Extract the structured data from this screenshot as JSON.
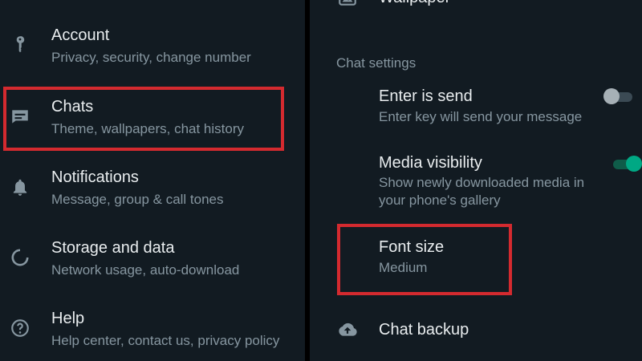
{
  "left_panel": {
    "items": [
      {
        "title": "Account",
        "subtitle": "Privacy, security, change number",
        "icon": "key-icon"
      },
      {
        "title": "Chats",
        "subtitle": "Theme, wallpapers, chat history",
        "icon": "chat-icon"
      },
      {
        "title": "Notifications",
        "subtitle": "Message, group & call tones",
        "icon": "bell-icon"
      },
      {
        "title": "Storage and data",
        "subtitle": "Network usage, auto-download",
        "icon": "storage-icon"
      },
      {
        "title": "Help",
        "subtitle": "Help center, contact us, privacy policy",
        "icon": "help-icon"
      }
    ]
  },
  "right_panel": {
    "wallpaper_label": "Wallpaper",
    "section_header": "Chat settings",
    "enter_is_send": {
      "title": "Enter is send",
      "subtitle": "Enter key will send your message",
      "enabled": false
    },
    "media_visibility": {
      "title": "Media visibility",
      "subtitle_line1": "Show newly downloaded media in",
      "subtitle_line2": "your phone's gallery",
      "enabled": true
    },
    "font_size": {
      "title": "Font size",
      "value": "Medium"
    },
    "chat_backup": {
      "title": "Chat backup",
      "icon": "cloud-upload-icon"
    }
  },
  "colors": {
    "background": "#121b22",
    "primary_text": "#e9edef",
    "secondary_text": "#8696a0",
    "icon": "#8696a0",
    "accent": "#00a884",
    "highlight": "#d42a2f"
  }
}
